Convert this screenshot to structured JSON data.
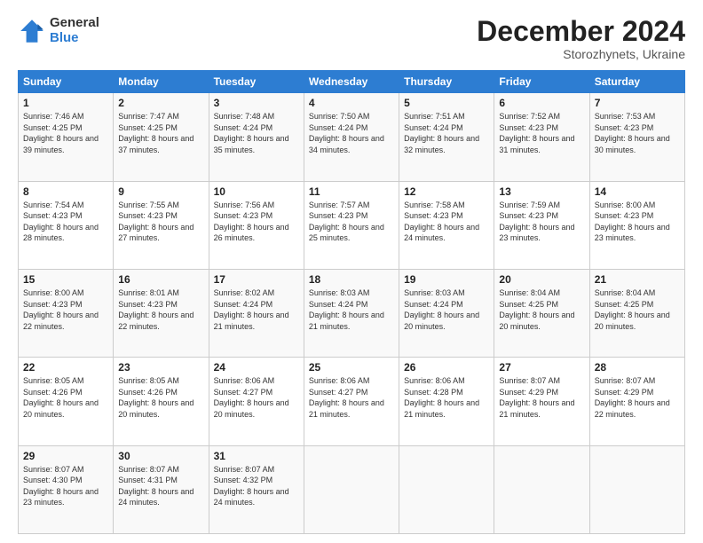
{
  "logo": {
    "general": "General",
    "blue": "Blue"
  },
  "title": {
    "month": "December 2024",
    "location": "Storozhynets, Ukraine"
  },
  "days_of_week": [
    "Sunday",
    "Monday",
    "Tuesday",
    "Wednesday",
    "Thursday",
    "Friday",
    "Saturday"
  ],
  "weeks": [
    [
      {
        "day": "1",
        "sunrise": "7:46 AM",
        "sunset": "4:25 PM",
        "daylight": "8 hours and 39 minutes."
      },
      {
        "day": "2",
        "sunrise": "7:47 AM",
        "sunset": "4:25 PM",
        "daylight": "8 hours and 37 minutes."
      },
      {
        "day": "3",
        "sunrise": "7:48 AM",
        "sunset": "4:24 PM",
        "daylight": "8 hours and 35 minutes."
      },
      {
        "day": "4",
        "sunrise": "7:50 AM",
        "sunset": "4:24 PM",
        "daylight": "8 hours and 34 minutes."
      },
      {
        "day": "5",
        "sunrise": "7:51 AM",
        "sunset": "4:24 PM",
        "daylight": "8 hours and 32 minutes."
      },
      {
        "day": "6",
        "sunrise": "7:52 AM",
        "sunset": "4:23 PM",
        "daylight": "8 hours and 31 minutes."
      },
      {
        "day": "7",
        "sunrise": "7:53 AM",
        "sunset": "4:23 PM",
        "daylight": "8 hours and 30 minutes."
      }
    ],
    [
      {
        "day": "8",
        "sunrise": "7:54 AM",
        "sunset": "4:23 PM",
        "daylight": "8 hours and 28 minutes."
      },
      {
        "day": "9",
        "sunrise": "7:55 AM",
        "sunset": "4:23 PM",
        "daylight": "8 hours and 27 minutes."
      },
      {
        "day": "10",
        "sunrise": "7:56 AM",
        "sunset": "4:23 PM",
        "daylight": "8 hours and 26 minutes."
      },
      {
        "day": "11",
        "sunrise": "7:57 AM",
        "sunset": "4:23 PM",
        "daylight": "8 hours and 25 minutes."
      },
      {
        "day": "12",
        "sunrise": "7:58 AM",
        "sunset": "4:23 PM",
        "daylight": "8 hours and 24 minutes."
      },
      {
        "day": "13",
        "sunrise": "7:59 AM",
        "sunset": "4:23 PM",
        "daylight": "8 hours and 23 minutes."
      },
      {
        "day": "14",
        "sunrise": "8:00 AM",
        "sunset": "4:23 PM",
        "daylight": "8 hours and 23 minutes."
      }
    ],
    [
      {
        "day": "15",
        "sunrise": "8:00 AM",
        "sunset": "4:23 PM",
        "daylight": "8 hours and 22 minutes."
      },
      {
        "day": "16",
        "sunrise": "8:01 AM",
        "sunset": "4:23 PM",
        "daylight": "8 hours and 22 minutes."
      },
      {
        "day": "17",
        "sunrise": "8:02 AM",
        "sunset": "4:24 PM",
        "daylight": "8 hours and 21 minutes."
      },
      {
        "day": "18",
        "sunrise": "8:03 AM",
        "sunset": "4:24 PM",
        "daylight": "8 hours and 21 minutes."
      },
      {
        "day": "19",
        "sunrise": "8:03 AM",
        "sunset": "4:24 PM",
        "daylight": "8 hours and 20 minutes."
      },
      {
        "day": "20",
        "sunrise": "8:04 AM",
        "sunset": "4:25 PM",
        "daylight": "8 hours and 20 minutes."
      },
      {
        "day": "21",
        "sunrise": "8:04 AM",
        "sunset": "4:25 PM",
        "daylight": "8 hours and 20 minutes."
      }
    ],
    [
      {
        "day": "22",
        "sunrise": "8:05 AM",
        "sunset": "4:26 PM",
        "daylight": "8 hours and 20 minutes."
      },
      {
        "day": "23",
        "sunrise": "8:05 AM",
        "sunset": "4:26 PM",
        "daylight": "8 hours and 20 minutes."
      },
      {
        "day": "24",
        "sunrise": "8:06 AM",
        "sunset": "4:27 PM",
        "daylight": "8 hours and 20 minutes."
      },
      {
        "day": "25",
        "sunrise": "8:06 AM",
        "sunset": "4:27 PM",
        "daylight": "8 hours and 21 minutes."
      },
      {
        "day": "26",
        "sunrise": "8:06 AM",
        "sunset": "4:28 PM",
        "daylight": "8 hours and 21 minutes."
      },
      {
        "day": "27",
        "sunrise": "8:07 AM",
        "sunset": "4:29 PM",
        "daylight": "8 hours and 21 minutes."
      },
      {
        "day": "28",
        "sunrise": "8:07 AM",
        "sunset": "4:29 PM",
        "daylight": "8 hours and 22 minutes."
      }
    ],
    [
      {
        "day": "29",
        "sunrise": "8:07 AM",
        "sunset": "4:30 PM",
        "daylight": "8 hours and 23 minutes."
      },
      {
        "day": "30",
        "sunrise": "8:07 AM",
        "sunset": "4:31 PM",
        "daylight": "8 hours and 24 minutes."
      },
      {
        "day": "31",
        "sunrise": "8:07 AM",
        "sunset": "4:32 PM",
        "daylight": "8 hours and 24 minutes."
      },
      null,
      null,
      null,
      null
    ]
  ]
}
